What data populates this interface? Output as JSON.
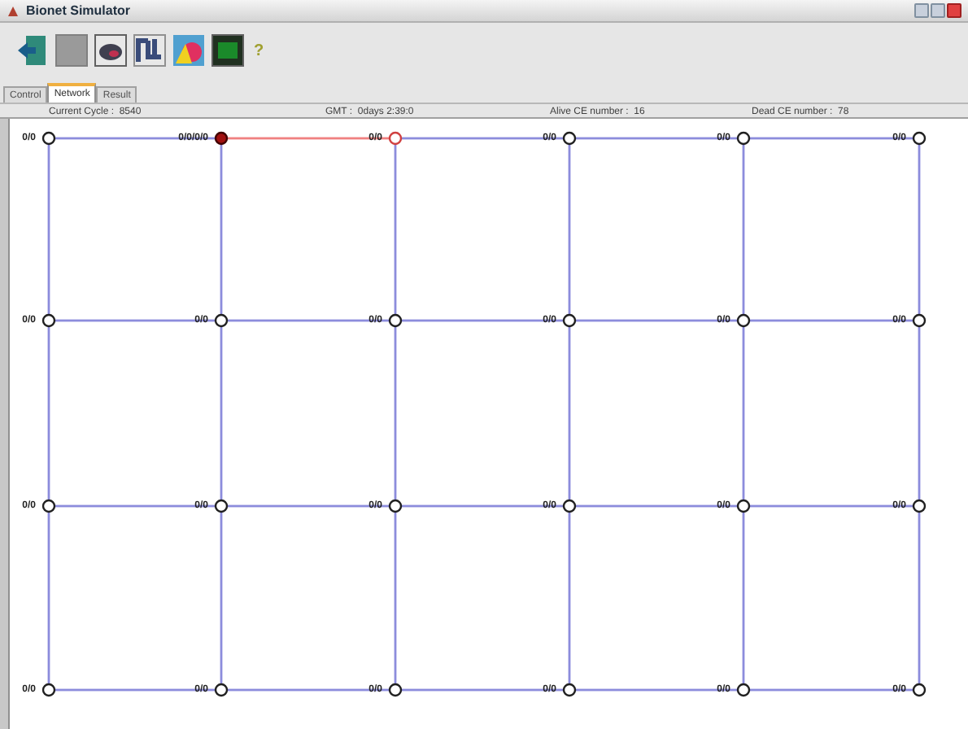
{
  "window": {
    "title": "Bionet Simulator"
  },
  "toolbar": {
    "help": "?"
  },
  "tabs": [
    {
      "label": "Control",
      "selected": false
    },
    {
      "label": "Network",
      "selected": true
    },
    {
      "label": "Result",
      "selected": false
    }
  ],
  "status": [
    "Current Cycle :  8540",
    "GMT :  0days 2:39:0",
    "Alive CE number :  16",
    "Dead CE number :  78"
  ],
  "network": [
    [
      {
        "label": "0/0",
        "sending": false,
        "receiving": false
      },
      {
        "label": "0/0/0/0",
        "sending": true,
        "receiving": false,
        "incoming_link_active": false
      },
      {
        "label": "0/0",
        "sending": false,
        "receiving": true,
        "incoming_link_active": true
      },
      {
        "label": "0/0",
        "sending": false,
        "receiving": false,
        "incoming_link_active": false
      },
      {
        "label": "0/0",
        "sending": false,
        "receiving": false,
        "incoming_link_active": false
      },
      {
        "label": "0/0",
        "sending": false,
        "receiving": false,
        "incoming_link_active": false
      }
    ],
    [
      {
        "label": "0/0",
        "sending": false,
        "receiving": false
      },
      {
        "label": "0/0",
        "sending": false,
        "receiving": false,
        "incoming_link_active": false
      },
      {
        "label": "0/0",
        "sending": false,
        "receiving": false,
        "incoming_link_active": false
      },
      {
        "label": "0/0",
        "sending": false,
        "receiving": false,
        "incoming_link_active": false
      },
      {
        "label": "0/0",
        "sending": false,
        "receiving": false,
        "incoming_link_active": false
      },
      {
        "label": "0/0",
        "sending": false,
        "receiving": false,
        "incoming_link_active": false
      }
    ],
    [
      {
        "label": "0/0",
        "sending": false,
        "receiving": false
      },
      {
        "label": "0/0",
        "sending": false,
        "receiving": false,
        "incoming_link_active": false
      },
      {
        "label": "0/0",
        "sending": false,
        "receiving": false,
        "incoming_link_active": false
      },
      {
        "label": "0/0",
        "sending": false,
        "receiving": false,
        "incoming_link_active": false
      },
      {
        "label": "0/0",
        "sending": false,
        "receiving": false,
        "incoming_link_active": false
      },
      {
        "label": "0/0",
        "sending": false,
        "receiving": false,
        "incoming_link_active": false
      }
    ],
    [
      {
        "label": "0/0",
        "sending": false,
        "receiving": false
      },
      {
        "label": "0/0",
        "sending": false,
        "receiving": false,
        "incoming_link_active": false
      },
      {
        "label": "0/0",
        "sending": false,
        "receiving": false,
        "incoming_link_active": false
      },
      {
        "label": "0/0",
        "sending": false,
        "receiving": false,
        "incoming_link_active": false
      },
      {
        "label": "0/0",
        "sending": false,
        "receiving": false,
        "incoming_link_active": false
      },
      {
        "label": "0/0",
        "sending": false,
        "receiving": false,
        "incoming_link_active": false
      }
    ]
  ]
}
